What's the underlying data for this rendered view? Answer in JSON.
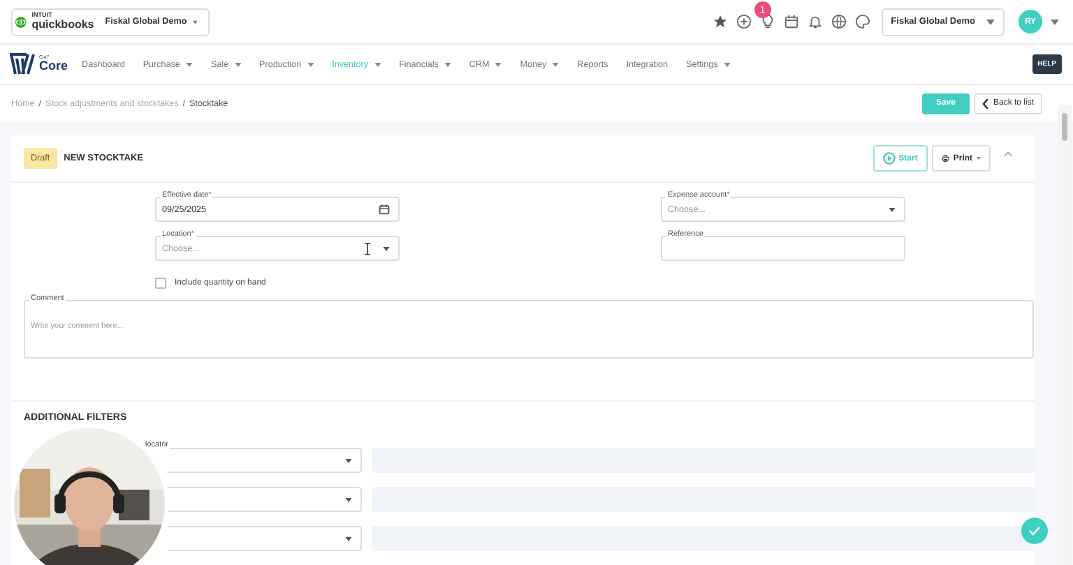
{
  "quickbooks": {
    "brand_top": "INTUIT",
    "brand": "quickbooks",
    "company": "Fiskal Global Demo"
  },
  "top_bar": {
    "notification_count": "1",
    "company": "Fiskal Global Demo",
    "avatar": "RY"
  },
  "logo": {
    "small": "Cin7",
    "name": "Core"
  },
  "nav": [
    {
      "label": "Dashboard",
      "selected": false,
      "dropdown": false
    },
    {
      "label": "Purchase",
      "selected": false,
      "dropdown": true
    },
    {
      "label": "Sale",
      "selected": false,
      "dropdown": true
    },
    {
      "label": "Production",
      "selected": false,
      "dropdown": true
    },
    {
      "label": "Inventory",
      "selected": true,
      "dropdown": true
    },
    {
      "label": "Financials",
      "selected": false,
      "dropdown": true
    },
    {
      "label": "CRM",
      "selected": false,
      "dropdown": true
    },
    {
      "label": "Money",
      "selected": false,
      "dropdown": true
    },
    {
      "label": "Reports",
      "selected": false,
      "dropdown": false
    },
    {
      "label": "Integration",
      "selected": false,
      "dropdown": false
    },
    {
      "label": "Settings",
      "selected": false,
      "dropdown": true
    }
  ],
  "help": "HELP",
  "breadcrumb": [
    {
      "label": "Home"
    },
    {
      "separator": "/",
      "label": "Stock adjustments and stocktakes"
    },
    {
      "separator": "/",
      "label": "Stocktake"
    }
  ],
  "actions": {
    "save": "Save",
    "back": "Back to list"
  },
  "card": {
    "status": "Draft",
    "title": "NEW STOCKTAKE",
    "start": "Start",
    "print": "Print"
  },
  "left_fields": [
    {
      "kind": "date",
      "label": "Effective date",
      "required_mark": "*",
      "value": "09/25/2025"
    },
    {
      "kind": "select",
      "label": "Location",
      "required_mark": "*",
      "placeholder": "Choose..."
    }
  ],
  "right_fields": [
    {
      "kind": "select",
      "label": "Expense account",
      "required_mark": "*",
      "placeholder": "Choose..."
    },
    {
      "kind": "text",
      "label": "Reference"
    }
  ],
  "include_quantity": {
    "label": "Include quantity on hand",
    "checked": false
  },
  "comment": {
    "label": "Comment",
    "placeholder": "Write your comment here..."
  },
  "filters": {
    "title": "ADDITIONAL FILTERS",
    "rows": [
      {
        "kind": "select",
        "label": "locator"
      },
      {
        "kind": "select"
      },
      {
        "kind": "select"
      }
    ]
  }
}
